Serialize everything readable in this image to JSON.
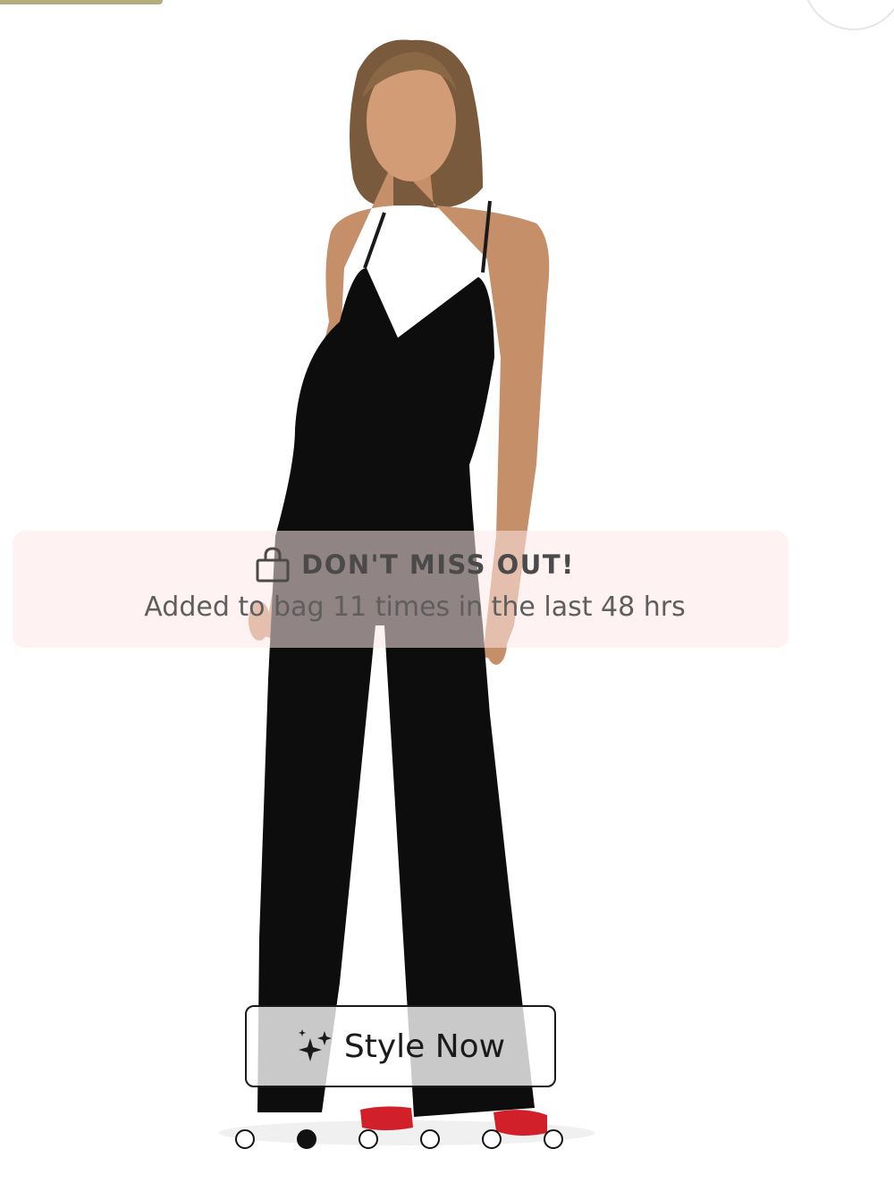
{
  "app": {
    "accent_color": "#b5ad7e"
  },
  "product": {
    "image_icon": "product-photo",
    "garment_color": "#0d0d0d",
    "shoe_color": "#d1202a"
  },
  "alert": {
    "icon": "shopping-bag-icon",
    "title": "DON'T MISS OUT!",
    "subtitle": "Added to bag 11 times in the last 48 hrs",
    "background": "#fde8e8"
  },
  "style_button": {
    "icon": "sparkle-icon",
    "label": "Style Now"
  },
  "carousel": {
    "total": 6,
    "active_index": 1
  }
}
